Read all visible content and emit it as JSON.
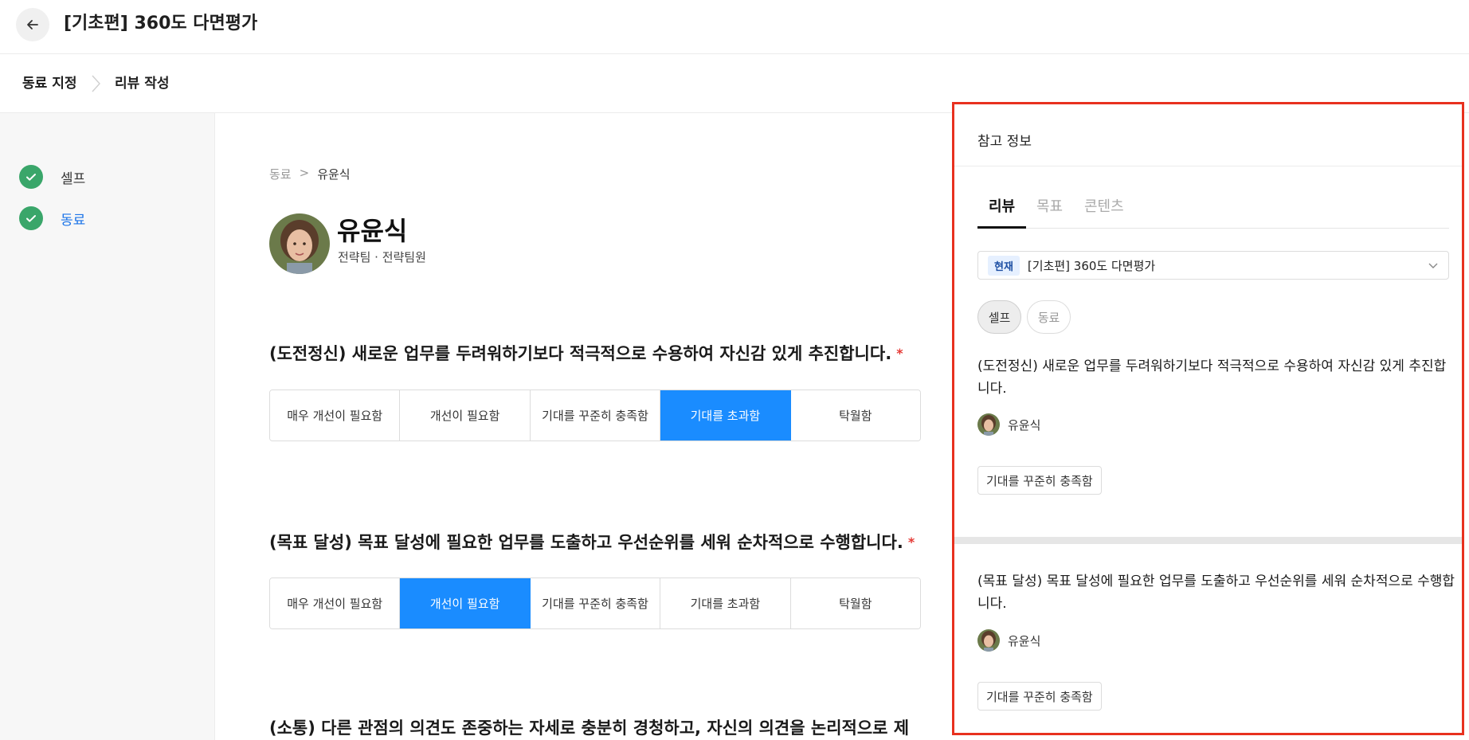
{
  "header": {
    "title": "[기초편] 360도 다면평가"
  },
  "steps": {
    "first": "동료 지정",
    "second": "리뷰 작성"
  },
  "sidebar": {
    "items": [
      {
        "label": "셀프"
      },
      {
        "label": "동료"
      }
    ]
  },
  "main": {
    "breadcrumb": {
      "parent": "동료",
      "sep": ">",
      "current": "유윤식"
    },
    "person": {
      "name": "유윤식",
      "dept": "전략팀 · 전략팀원"
    },
    "required_mark": "*",
    "questions": [
      {
        "title": "(도전정신) 새로운 업무를 두려워하기보다 적극적으로 수용하여 자신감 있게 추진합니다.",
        "selected": 3
      },
      {
        "title": "(목표 달성) 목표 달성에 필요한 업무를 도출하고 우선순위를 세워 순차적으로 수행합니다.",
        "selected": 1
      },
      {
        "title": "(소통) 다른 관점의 의견도 존중하는 자세로 충분히 경청하고, 자신의 의견을 논리적으로 제"
      }
    ],
    "scale_options": [
      "매우 개선이 필요함",
      "개선이 필요함",
      "기대를 꾸준히 충족함",
      "기대를 초과함",
      "탁월함"
    ]
  },
  "panel": {
    "title": "참고 정보",
    "tabs": [
      "리뷰",
      "목표",
      "콘텐츠"
    ],
    "active_tab": 0,
    "select": {
      "badge": "현재",
      "value": "[기초편] 360도 다면평가"
    },
    "pills": [
      "셀프",
      "동료"
    ],
    "active_pill": 0,
    "refs": [
      {
        "question": "(도전정신) 새로운 업무를 두려워하기보다 적극적으로 수용하여 자신감 있게 추진합니다.",
        "user": "유윤식",
        "answer": "기대를 꾸준히 충족함"
      },
      {
        "question": "(목표 달성) 목표 달성에 필요한 업무를 도출하고 우선순위를 세워 순차적으로 수행합니다.",
        "user": "유윤식",
        "answer": "기대를 꾸준히 충족함"
      }
    ]
  },
  "icons": {
    "back": "arrow-left-icon",
    "step_sep": "chevron-right-icon",
    "check": "check-icon",
    "select": "chevron-down-icon"
  },
  "colors": {
    "accent": "#1a8cff",
    "success": "#3aa66a",
    "highlight_frame": "#e8311f",
    "required": "#e53935"
  }
}
